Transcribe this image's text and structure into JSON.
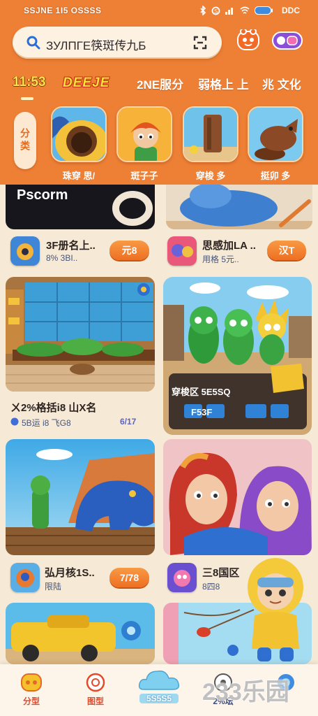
{
  "status_bar": {
    "left_text": "SSJNE 1I5 OSSSS",
    "right_text": "DDC"
  },
  "search": {
    "text": "ЗУЛПГЕ筷斑传九Б"
  },
  "tabs": [
    {
      "label": "11:53"
    },
    {
      "label": "DEEJE"
    },
    {
      "label": "2NE服分"
    },
    {
      "label": "弱格上 上"
    },
    {
      "label": "兆 文化"
    }
  ],
  "category_pill": {
    "label": "分类"
  },
  "featured_games": [
    {
      "label": "珠穿 思/"
    },
    {
      "label": "斑子子"
    },
    {
      "label": "穿梭 多"
    },
    {
      "label": "挺卯 多"
    }
  ],
  "feed": {
    "row1": {
      "left": {
        "image_text": "Pscorm",
        "title": "3F册名上..",
        "subtitle": "8% 3BI..",
        "button": "元8"
      },
      "right": {
        "title": "思感加LA ..",
        "subtitle": "用格 5元..",
        "button": "汉T"
      }
    },
    "row2": {
      "left": {
        "title": "ㄨ2%格括i8 山X名",
        "subtitle": "5B运 i8 飞G8",
        "tag": "6/17"
      },
      "right": {
        "image_text_1": "穿梭区 5E5SQ",
        "image_text_2": "F53F"
      }
    },
    "row3": {
      "left": {
        "title": "弘月核1S..",
        "subtitle": "限陆",
        "button": "7/78"
      },
      "right": {
        "title": "三8国区",
        "subtitle": "8四8"
      }
    }
  },
  "nav": [
    {
      "label": "分型"
    },
    {
      "label": "图型"
    },
    {
      "label": "5S5S5"
    },
    {
      "label": "2%坛"
    }
  ],
  "watermark": "233乐园",
  "icons": {
    "status": [
      "bluetooth-icon",
      "sync-icon",
      "signal-icon",
      "wifi-icon",
      "battery-icon"
    ],
    "search": "search-icon",
    "scan": "scan-icon",
    "header": [
      "face-icon",
      "gamepad-icon"
    ],
    "nav": [
      "game-face-icon",
      "badge-icon",
      "cloud-icon",
      "circle-icon",
      "globe-icon"
    ]
  },
  "colors": {
    "header": "#ee8035",
    "background": "#f6ead6",
    "button": "#f07a2b",
    "tab_active": "#ffe14d",
    "subtitle": "#46557a"
  }
}
